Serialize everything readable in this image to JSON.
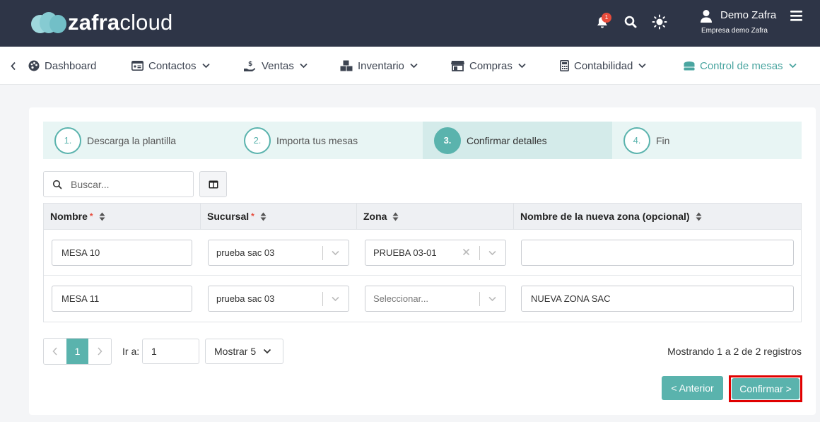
{
  "header": {
    "logo_bold": "zafra",
    "logo_light": "cloud",
    "notification_count": "1",
    "user_name": "Demo Zafra",
    "company": "Empresa demo Zafra"
  },
  "menu": {
    "items": [
      {
        "label": "Dashboard",
        "icon": "palette-icon"
      },
      {
        "label": "Contactos",
        "icon": "id-card-icon"
      },
      {
        "label": "Ventas",
        "icon": "hand-dollar-icon"
      },
      {
        "label": "Inventario",
        "icon": "boxes-icon"
      },
      {
        "label": "Compras",
        "icon": "store-icon"
      },
      {
        "label": "Contabilidad",
        "icon": "calculator-icon"
      },
      {
        "label": "Control de mesas",
        "icon": "table-icon",
        "active": true
      }
    ]
  },
  "stepper": {
    "steps": [
      {
        "num": "1.",
        "label": "Descarga la plantilla"
      },
      {
        "num": "2.",
        "label": "Importa tus mesas"
      },
      {
        "num": "3.",
        "label": "Confirmar detalles",
        "active": true
      },
      {
        "num": "4.",
        "label": "Fin"
      }
    ]
  },
  "search": {
    "placeholder": "Buscar..."
  },
  "table": {
    "headers": [
      "Nombre",
      "Sucursal",
      "Zona",
      "Nombre de la nueva zona (opcional)"
    ],
    "rows": [
      {
        "nombre": "MESA 10",
        "sucursal": "prueba sac 03",
        "zona": "PRUEBA 03-01",
        "nueva_zona": ""
      },
      {
        "nombre": "MESA 11",
        "sucursal": "prueba sac 03",
        "zona_placeholder": "Seleccionar...",
        "nueva_zona": "NUEVA ZONA SAC"
      }
    ]
  },
  "pagination": {
    "current_page": "1",
    "goto_label": "Ir a:",
    "goto_value": "1",
    "page_size_label": "Mostrar 5",
    "records_text": "Mostrando 1 a 2 de 2 registros"
  },
  "actions": {
    "prev_label": "< Anterior",
    "confirm_label": "Confirmar >"
  },
  "colors": {
    "accent": "#5ab3ad",
    "topbar": "#2e3547",
    "highlight": "#e00000"
  }
}
